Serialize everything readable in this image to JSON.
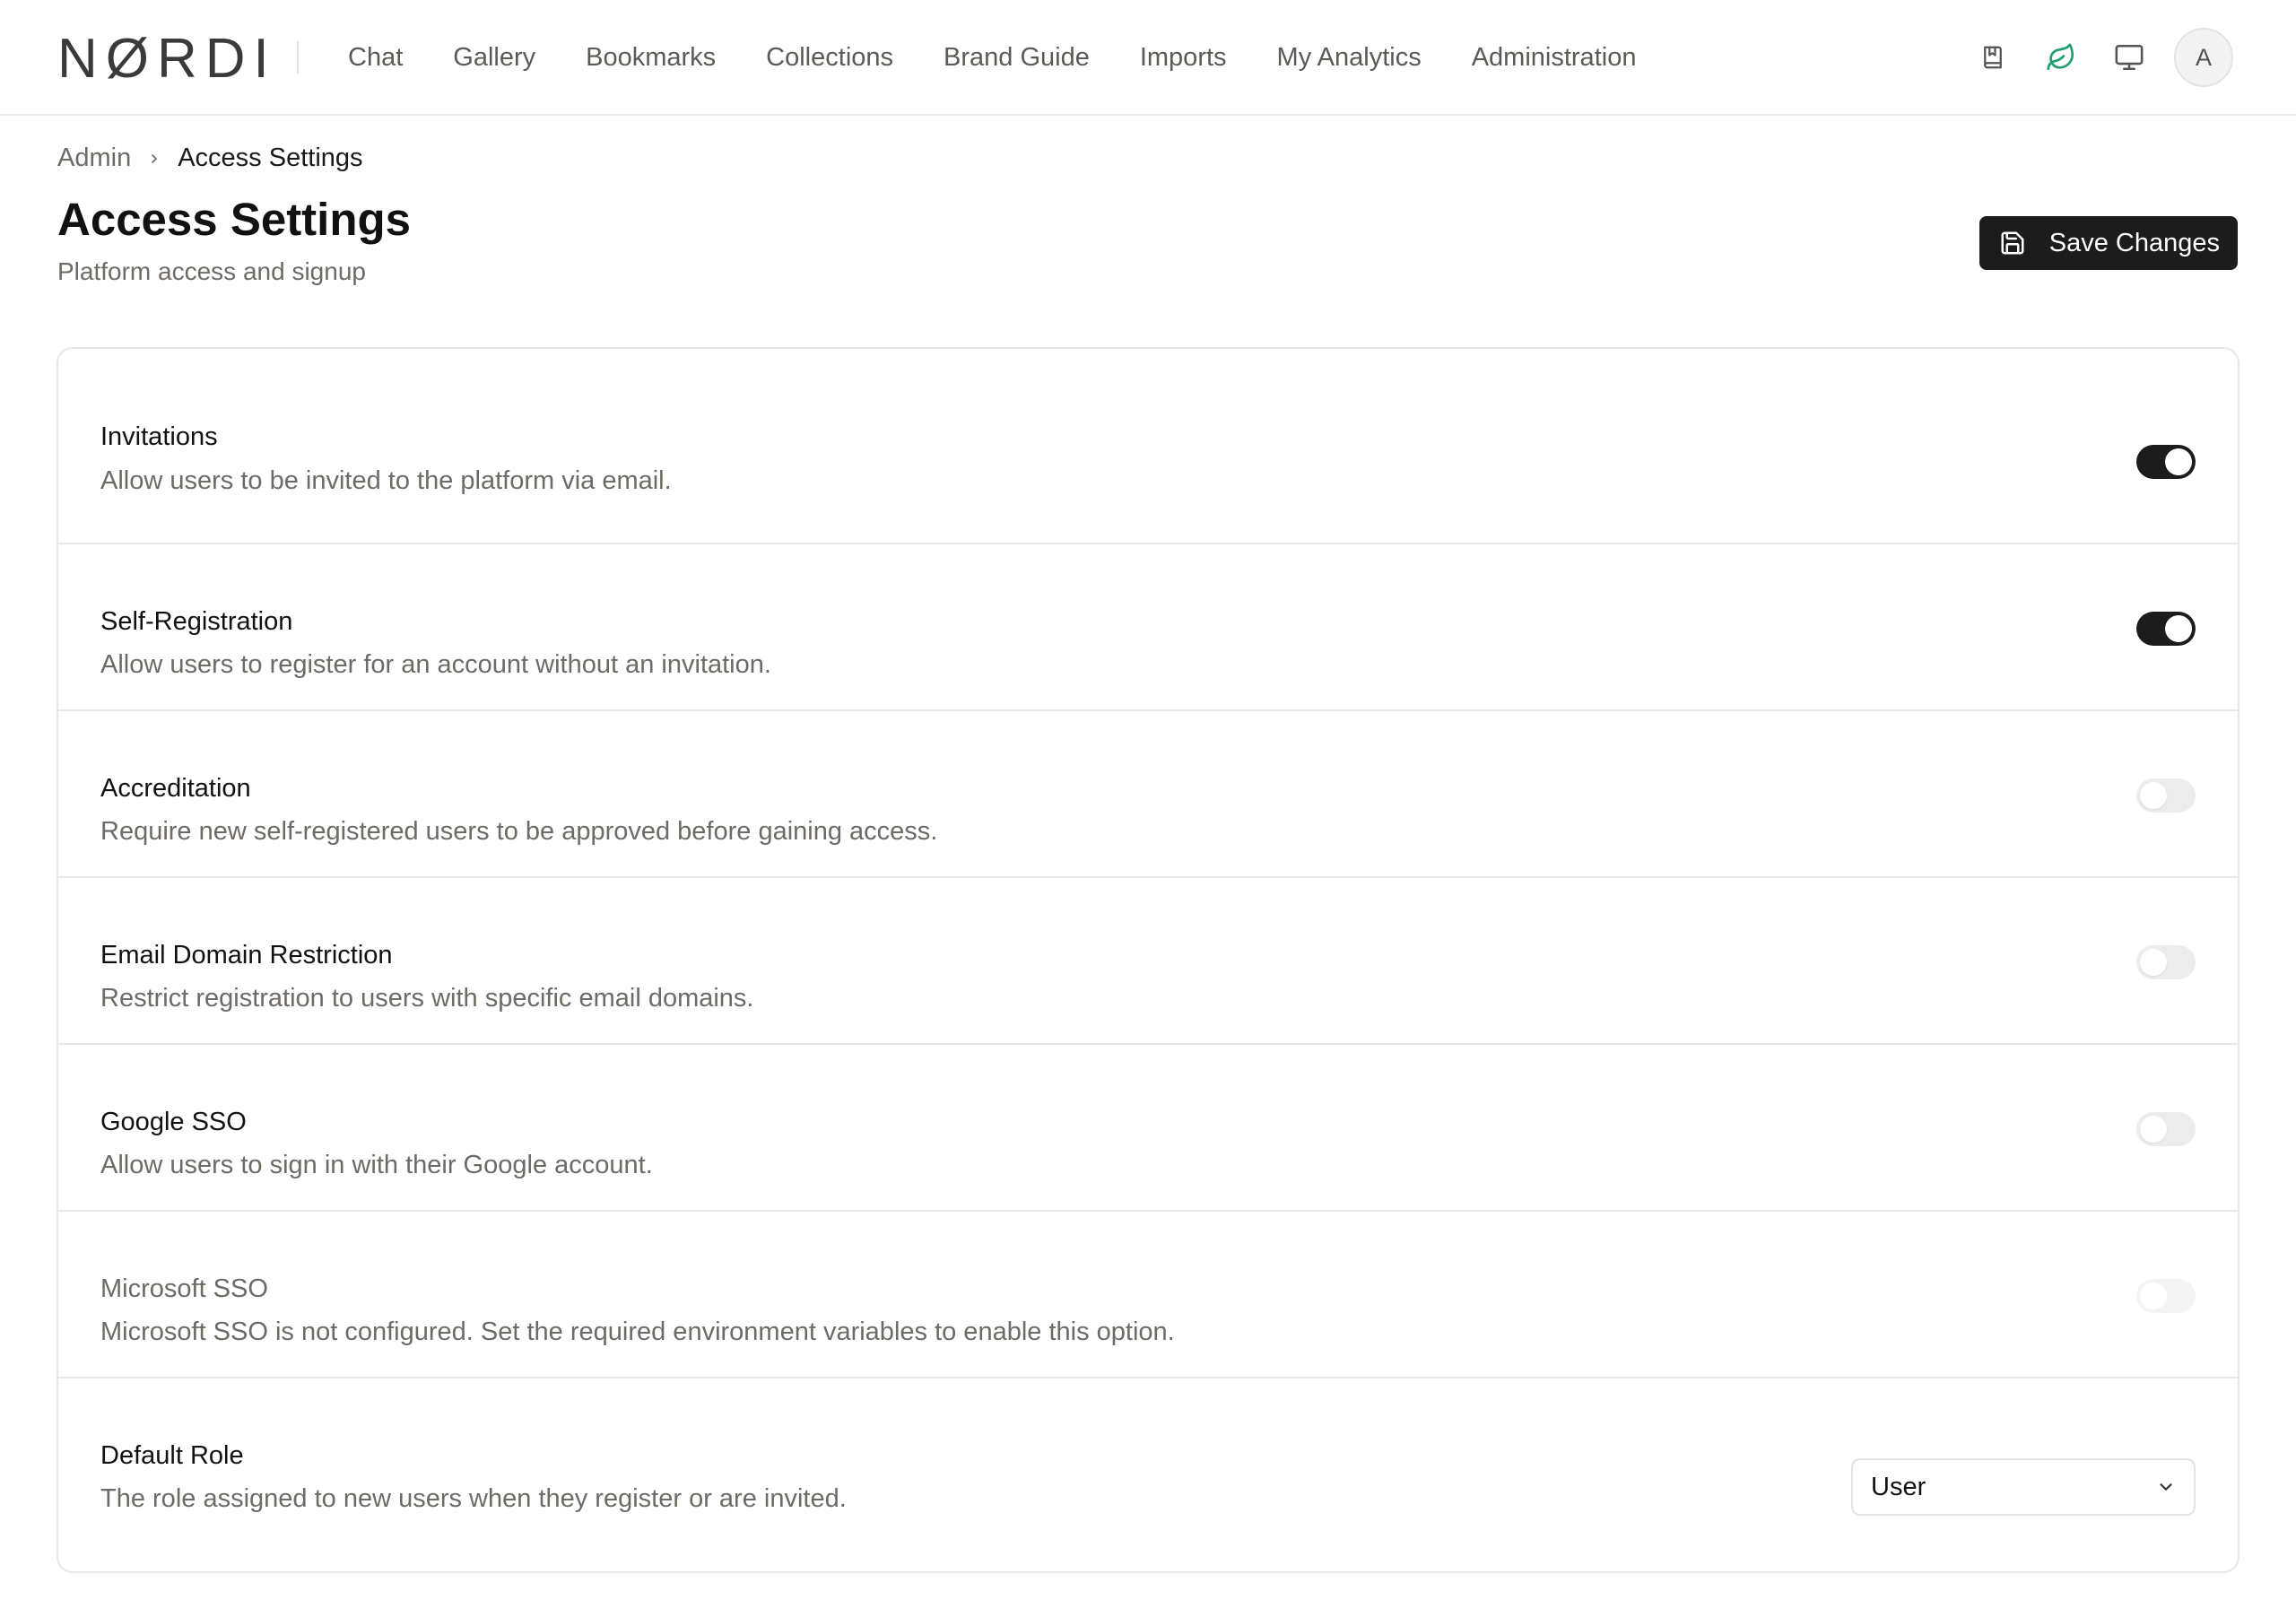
{
  "brand": {
    "logo": "NØRDI"
  },
  "nav": {
    "links": [
      "Chat",
      "Gallery",
      "Bookmarks",
      "Collections",
      "Brand Guide",
      "Imports",
      "My Analytics",
      "Administration"
    ],
    "icons": [
      "bookmark-book-icon",
      "leaf-icon",
      "monitor-icon"
    ],
    "avatar_initial": "A"
  },
  "breadcrumb": {
    "parent": "Admin",
    "current": "Access Settings"
  },
  "header": {
    "title": "Access Settings",
    "subtitle": "Platform access and signup",
    "save_label": "Save Changes"
  },
  "settings": [
    {
      "title": "Invitations",
      "description": "Allow users to be invited to the platform via email.",
      "enabled": true
    },
    {
      "title": "Self-Registration",
      "description": "Allow users to register for an account without an invitation.",
      "enabled": true
    },
    {
      "title": "Accreditation",
      "description": "Require new self-registered users to be approved before gaining access.",
      "enabled": false
    },
    {
      "title": "Email Domain Restriction",
      "description": "Restrict registration to users with specific email domains.",
      "enabled": false
    },
    {
      "title": "Google SSO",
      "description": "Allow users to sign in with their Google account.",
      "enabled": false
    },
    {
      "title": "Microsoft SSO",
      "description": "Microsoft SSO is not configured. Set the required environment variables to enable this option.",
      "enabled": false,
      "disabled": true
    }
  ],
  "default_role": {
    "title": "Default Role",
    "description": "The role assigned to new users when they register or are invited.",
    "selected": "User"
  },
  "colors": {
    "accent_dark": "#1c1c1c",
    "muted_text": "#6e6a65",
    "leaf_icon": "#1f9e6e",
    "border": "#e8e8e8"
  }
}
